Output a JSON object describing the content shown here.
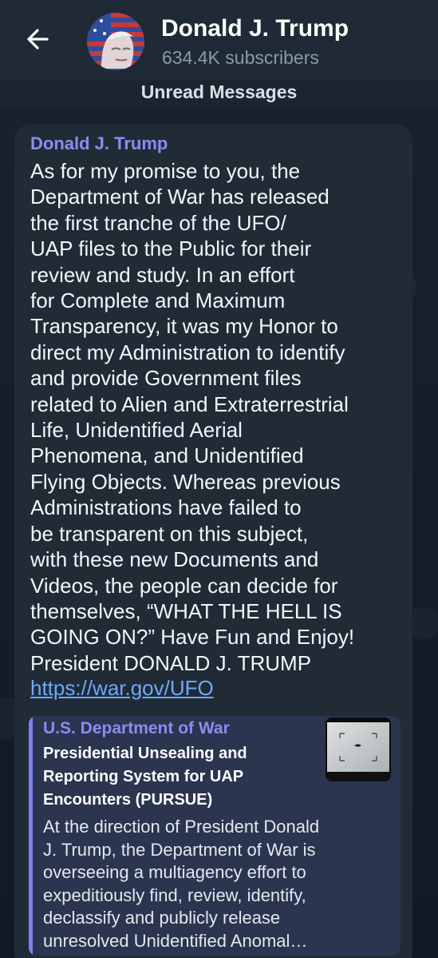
{
  "header": {
    "back_icon": "arrow-left-icon",
    "avatar_icon": "american-flag-portrait-avatar",
    "title": "Donald J. Trump",
    "subtitle": "634.4K subscribers"
  },
  "unread": {
    "label": "Unread Messages"
  },
  "message": {
    "sender": "Donald J. Trump",
    "text": "As for my promise to you, the\nDepartment of War has released\nthe first tranche of the UFO/\nUAP files to the Public for their\nreview and study. In an effort\nfor Complete and Maximum\nTransparency, it was my Honor to\ndirect my Administration to identify\nand provide Government files\nrelated to Alien and Extraterrestrial\nLife, Unidentified Aerial\nPhenomena, and Unidentified\nFlying Objects. Whereas previous\nAdministrations have failed to\nbe transparent on this subject,\nwith these new Documents and\nVideos, the people can decide for\nthemselves, “WHAT THE HELL IS\nGOING ON?” Have Fun and Enjoy!\nPresident DONALD J. TRUMP",
    "link": "https://war.gov/UFO",
    "preview": {
      "site": "U.S. Department of War",
      "title": "Presidential Unsealing and\nReporting System for UAP\nEncounters (PURSUE)",
      "description": "At the direction of President Donald\nJ. Trump, the Department of War is\noverseeing a multiagency effort to\nexpeditiously find, review, identify,\ndeclassify and publicly release\nunresolved Unidentified Anomal…",
      "thumbnail_icon": "ufo-video-thumbnail"
    }
  },
  "colors": {
    "background": "#0e1621",
    "header": "#1f2a36",
    "bubble": "#202b36",
    "accent": "#8b8cf0",
    "link": "#6ea8ff",
    "preview": "#2b3550"
  }
}
